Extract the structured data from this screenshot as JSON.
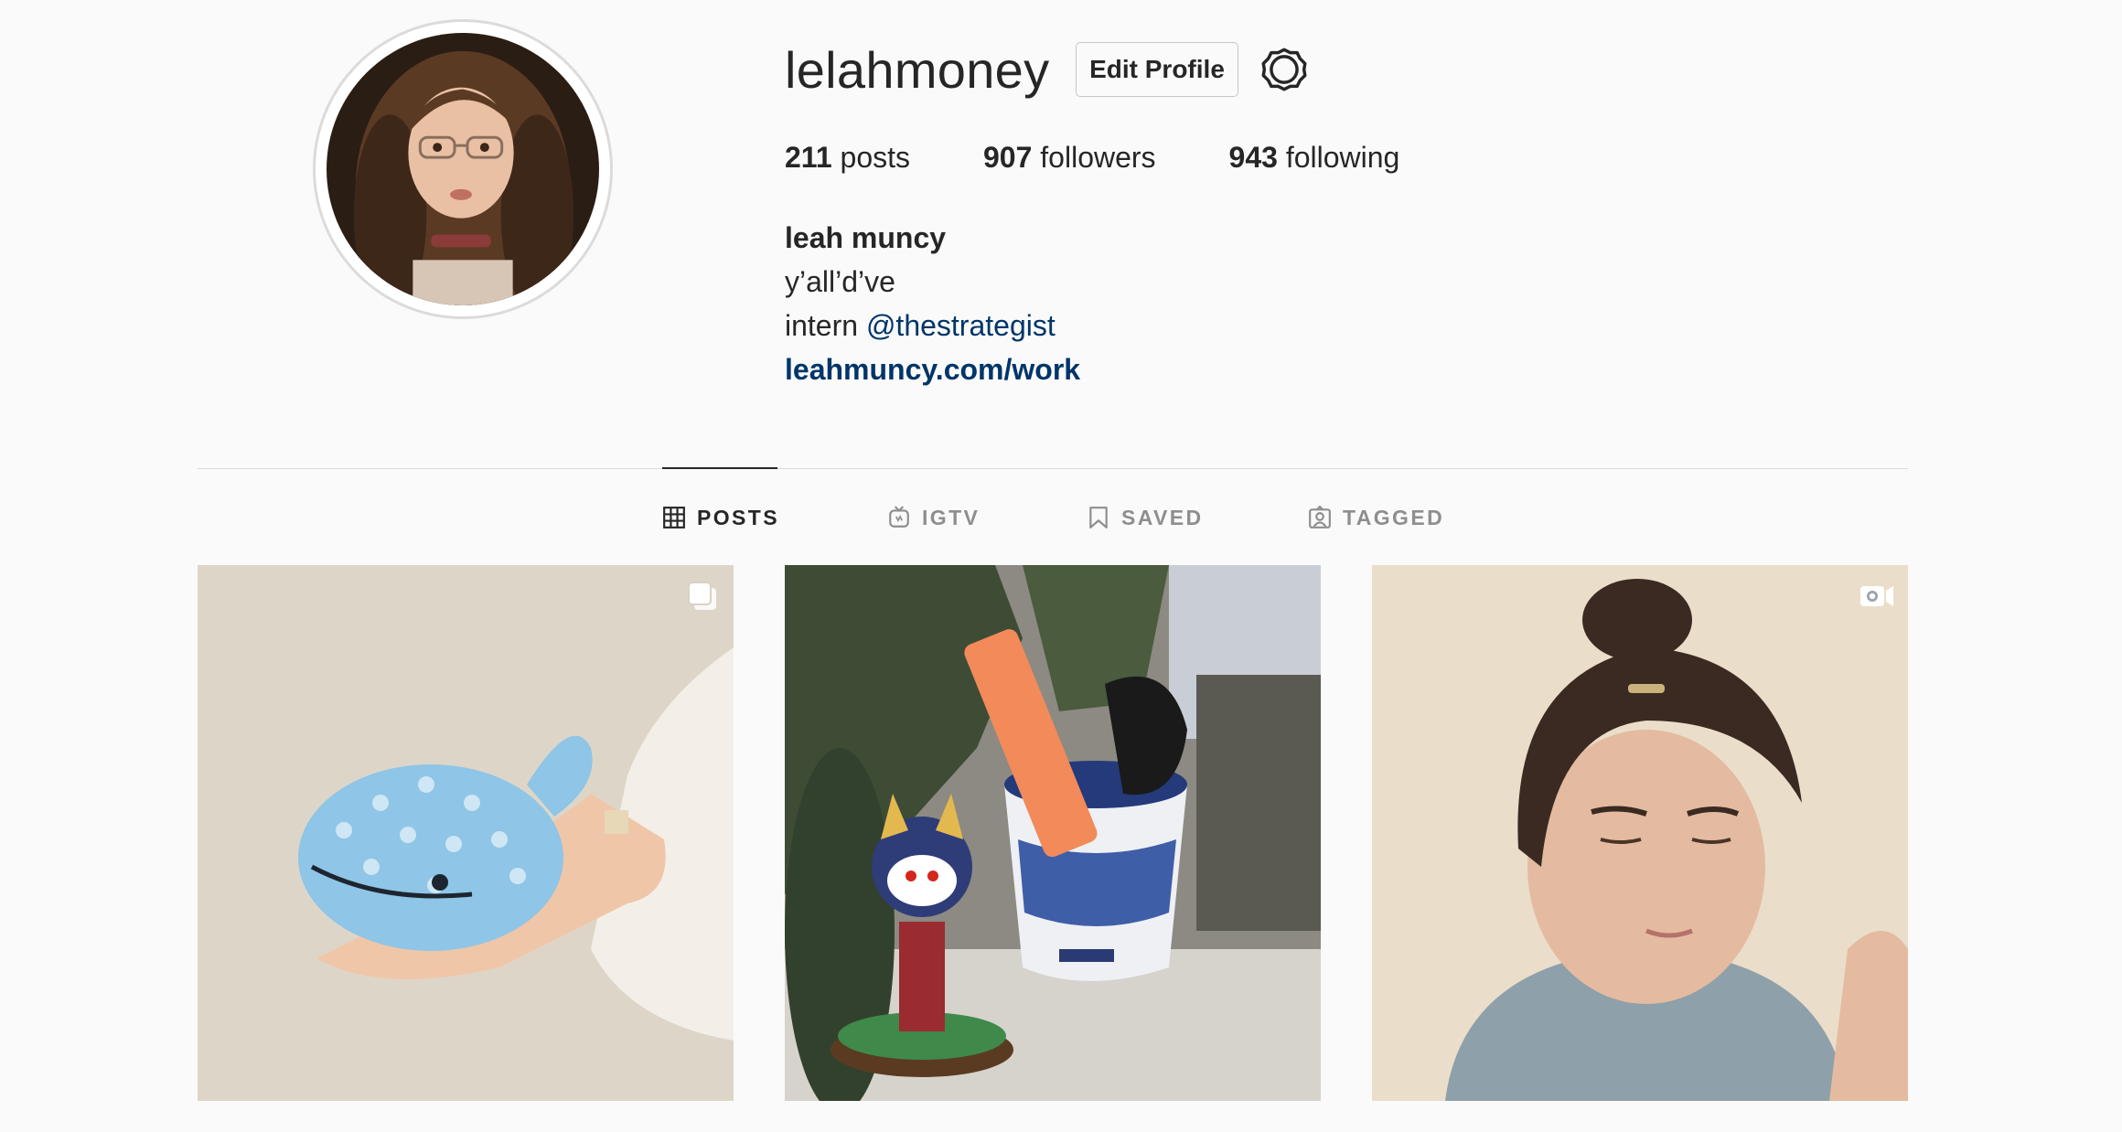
{
  "profile": {
    "username": "lelahmoney",
    "edit_label": "Edit Profile",
    "stats": {
      "posts_count": "211",
      "posts_label": "posts",
      "followers_count": "907",
      "followers_label": "followers",
      "following_count": "943",
      "following_label": "following"
    },
    "bio": {
      "name": "leah muncy",
      "line1": "y’all’d’ve",
      "line2_prefix": "intern",
      "mention": "@thestrategist",
      "link": "leahmuncy.com/work"
    }
  },
  "tabs": [
    {
      "label": "POSTS",
      "icon": "grid-icon",
      "active": true
    },
    {
      "label": "IGTV",
      "icon": "igtv-icon",
      "active": false
    },
    {
      "label": "SAVED",
      "icon": "bookmark-icon",
      "active": false
    },
    {
      "label": "TAGGED",
      "icon": "tagged-icon",
      "active": false
    }
  ],
  "posts": [
    {
      "badge": "carousel-icon",
      "subject": "whale-plush-in-hand"
    },
    {
      "badge": null,
      "subject": "desk-figurine-and-highlighter"
    },
    {
      "badge": "video-icon",
      "subject": "portrait"
    }
  ],
  "colors": {
    "link": "#003569",
    "text": "#262626",
    "muted": "#8e8e8e",
    "border": "#dbdbdb"
  }
}
